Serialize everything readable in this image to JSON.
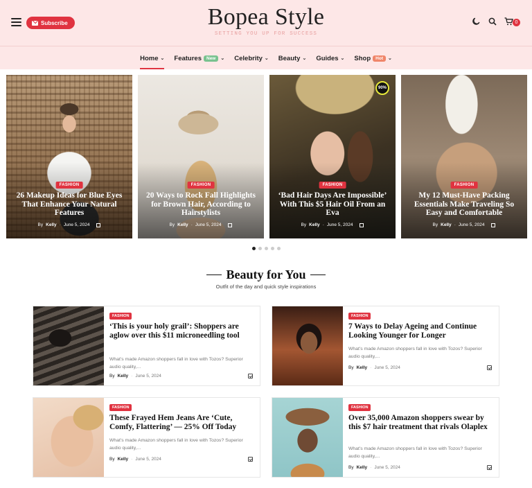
{
  "header": {
    "subscribe_label": "Subscribe",
    "logo": "Bopea Style",
    "tagline": "SETTING YOU UP FOR SUCCESS",
    "cart_count": "0",
    "icons": [
      "menu-icon",
      "moon-icon",
      "search-icon",
      "cart-icon"
    ]
  },
  "nav": {
    "items": [
      {
        "label": "Home"
      },
      {
        "label": "Features",
        "badge": "New"
      },
      {
        "label": "Celebrity"
      },
      {
        "label": "Beauty"
      },
      {
        "label": "Guides"
      },
      {
        "label": "Shop",
        "badge": "Hot"
      }
    ],
    "colors": {
      "accent": "#e03340",
      "new_badge": "#79c28f",
      "hot_badge": "#f0866a"
    }
  },
  "slider": {
    "slides": [
      {
        "category": "FASHION",
        "title": "26 Makeup Ideas for Blue Eyes That Enhance Your Natural Features",
        "by": "By",
        "author": "Kelly",
        "date": "June 5, 2024"
      },
      {
        "category": "FASHION",
        "title": "20 Ways to Rock Fall Highlights for Brown Hair, According to Hairstylists",
        "by": "By",
        "author": "Kelly",
        "date": "June 5, 2024"
      },
      {
        "category": "FASHION",
        "title": "‘Bad Hair Days Are Impossible’ With This $5 Hair Oil From an Eva",
        "by": "By",
        "author": "Kelly",
        "date": "June 5, 2024",
        "score": "90%"
      },
      {
        "category": "FASHION",
        "title": "My 12 Must-Have Packing Essentials Make Traveling So Easy and Comfortable",
        "by": "By",
        "author": "Kelly",
        "date": "June 5, 2024"
      }
    ],
    "active_dot": 1,
    "dot_count": 5
  },
  "section": {
    "title": "Beauty for You",
    "subtitle": "Outfit of the day and quick style inspirations",
    "cards": [
      {
        "category": "FASHION",
        "title": "‘This is your holy grail’: Shoppers are aglow over this $11 microneedling tool",
        "excerpt": "What’s made Amazon shoppers fall in love with Tozos? Superior audio quality,...",
        "by": "By",
        "author": "Kelly",
        "date": "June 5, 2024"
      },
      {
        "category": "FASHION",
        "title": "7 Ways to Delay Ageing and Continue Looking Younger for Longer",
        "excerpt": "What’s made Amazon shoppers fall in love with Tozos? Superior audio quality,...",
        "by": "By",
        "author": "Kelly",
        "date": "June 5, 2024"
      },
      {
        "category": "FASHION",
        "title": "These Frayed Hem Jeans Are ‘Cute, Comfy, Flattering’ — 25% Off Today",
        "excerpt": "What’s made Amazon shoppers fall in love with Tozos? Superior audio quality,...",
        "by": "By",
        "author": "Kelly",
        "date": "June 5, 2024"
      },
      {
        "category": "FASHION",
        "title": "Over 35,000 Amazon shoppers swear by this $7 hair treatment that rivals Olaplex",
        "excerpt": "What’s made Amazon shoppers fall in love with Tozos? Superior audio quality,...",
        "by": "By",
        "author": "Kelly",
        "date": "June 5, 2024"
      }
    ]
  }
}
